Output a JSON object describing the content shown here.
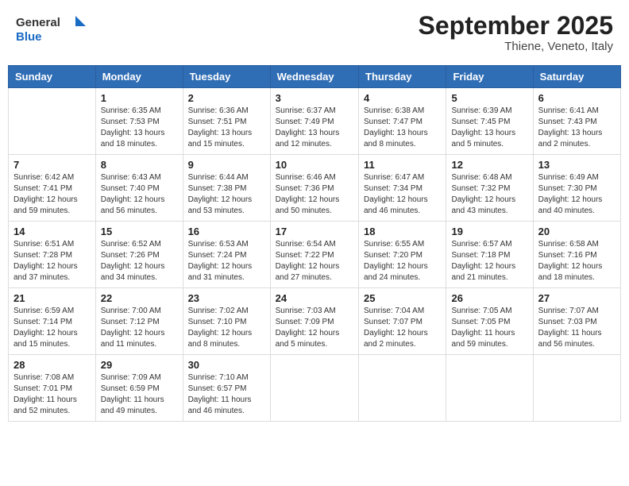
{
  "header": {
    "logo_general": "General",
    "logo_blue": "Blue",
    "month_title": "September 2025",
    "subtitle": "Thiene, Veneto, Italy"
  },
  "weekdays": [
    "Sunday",
    "Monday",
    "Tuesday",
    "Wednesday",
    "Thursday",
    "Friday",
    "Saturday"
  ],
  "weeks": [
    [
      {
        "day": "",
        "info": ""
      },
      {
        "day": "1",
        "info": "Sunrise: 6:35 AM\nSunset: 7:53 PM\nDaylight: 13 hours\nand 18 minutes."
      },
      {
        "day": "2",
        "info": "Sunrise: 6:36 AM\nSunset: 7:51 PM\nDaylight: 13 hours\nand 15 minutes."
      },
      {
        "day": "3",
        "info": "Sunrise: 6:37 AM\nSunset: 7:49 PM\nDaylight: 13 hours\nand 12 minutes."
      },
      {
        "day": "4",
        "info": "Sunrise: 6:38 AM\nSunset: 7:47 PM\nDaylight: 13 hours\nand 8 minutes."
      },
      {
        "day": "5",
        "info": "Sunrise: 6:39 AM\nSunset: 7:45 PM\nDaylight: 13 hours\nand 5 minutes."
      },
      {
        "day": "6",
        "info": "Sunrise: 6:41 AM\nSunset: 7:43 PM\nDaylight: 13 hours\nand 2 minutes."
      }
    ],
    [
      {
        "day": "7",
        "info": "Sunrise: 6:42 AM\nSunset: 7:41 PM\nDaylight: 12 hours\nand 59 minutes."
      },
      {
        "day": "8",
        "info": "Sunrise: 6:43 AM\nSunset: 7:40 PM\nDaylight: 12 hours\nand 56 minutes."
      },
      {
        "day": "9",
        "info": "Sunrise: 6:44 AM\nSunset: 7:38 PM\nDaylight: 12 hours\nand 53 minutes."
      },
      {
        "day": "10",
        "info": "Sunrise: 6:46 AM\nSunset: 7:36 PM\nDaylight: 12 hours\nand 50 minutes."
      },
      {
        "day": "11",
        "info": "Sunrise: 6:47 AM\nSunset: 7:34 PM\nDaylight: 12 hours\nand 46 minutes."
      },
      {
        "day": "12",
        "info": "Sunrise: 6:48 AM\nSunset: 7:32 PM\nDaylight: 12 hours\nand 43 minutes."
      },
      {
        "day": "13",
        "info": "Sunrise: 6:49 AM\nSunset: 7:30 PM\nDaylight: 12 hours\nand 40 minutes."
      }
    ],
    [
      {
        "day": "14",
        "info": "Sunrise: 6:51 AM\nSunset: 7:28 PM\nDaylight: 12 hours\nand 37 minutes."
      },
      {
        "day": "15",
        "info": "Sunrise: 6:52 AM\nSunset: 7:26 PM\nDaylight: 12 hours\nand 34 minutes."
      },
      {
        "day": "16",
        "info": "Sunrise: 6:53 AM\nSunset: 7:24 PM\nDaylight: 12 hours\nand 31 minutes."
      },
      {
        "day": "17",
        "info": "Sunrise: 6:54 AM\nSunset: 7:22 PM\nDaylight: 12 hours\nand 27 minutes."
      },
      {
        "day": "18",
        "info": "Sunrise: 6:55 AM\nSunset: 7:20 PM\nDaylight: 12 hours\nand 24 minutes."
      },
      {
        "day": "19",
        "info": "Sunrise: 6:57 AM\nSunset: 7:18 PM\nDaylight: 12 hours\nand 21 minutes."
      },
      {
        "day": "20",
        "info": "Sunrise: 6:58 AM\nSunset: 7:16 PM\nDaylight: 12 hours\nand 18 minutes."
      }
    ],
    [
      {
        "day": "21",
        "info": "Sunrise: 6:59 AM\nSunset: 7:14 PM\nDaylight: 12 hours\nand 15 minutes."
      },
      {
        "day": "22",
        "info": "Sunrise: 7:00 AM\nSunset: 7:12 PM\nDaylight: 12 hours\nand 11 minutes."
      },
      {
        "day": "23",
        "info": "Sunrise: 7:02 AM\nSunset: 7:10 PM\nDaylight: 12 hours\nand 8 minutes."
      },
      {
        "day": "24",
        "info": "Sunrise: 7:03 AM\nSunset: 7:09 PM\nDaylight: 12 hours\nand 5 minutes."
      },
      {
        "day": "25",
        "info": "Sunrise: 7:04 AM\nSunset: 7:07 PM\nDaylight: 12 hours\nand 2 minutes."
      },
      {
        "day": "26",
        "info": "Sunrise: 7:05 AM\nSunset: 7:05 PM\nDaylight: 11 hours\nand 59 minutes."
      },
      {
        "day": "27",
        "info": "Sunrise: 7:07 AM\nSunset: 7:03 PM\nDaylight: 11 hours\nand 56 minutes."
      }
    ],
    [
      {
        "day": "28",
        "info": "Sunrise: 7:08 AM\nSunset: 7:01 PM\nDaylight: 11 hours\nand 52 minutes."
      },
      {
        "day": "29",
        "info": "Sunrise: 7:09 AM\nSunset: 6:59 PM\nDaylight: 11 hours\nand 49 minutes."
      },
      {
        "day": "30",
        "info": "Sunrise: 7:10 AM\nSunset: 6:57 PM\nDaylight: 11 hours\nand 46 minutes."
      },
      {
        "day": "",
        "info": ""
      },
      {
        "day": "",
        "info": ""
      },
      {
        "day": "",
        "info": ""
      },
      {
        "day": "",
        "info": ""
      }
    ]
  ]
}
